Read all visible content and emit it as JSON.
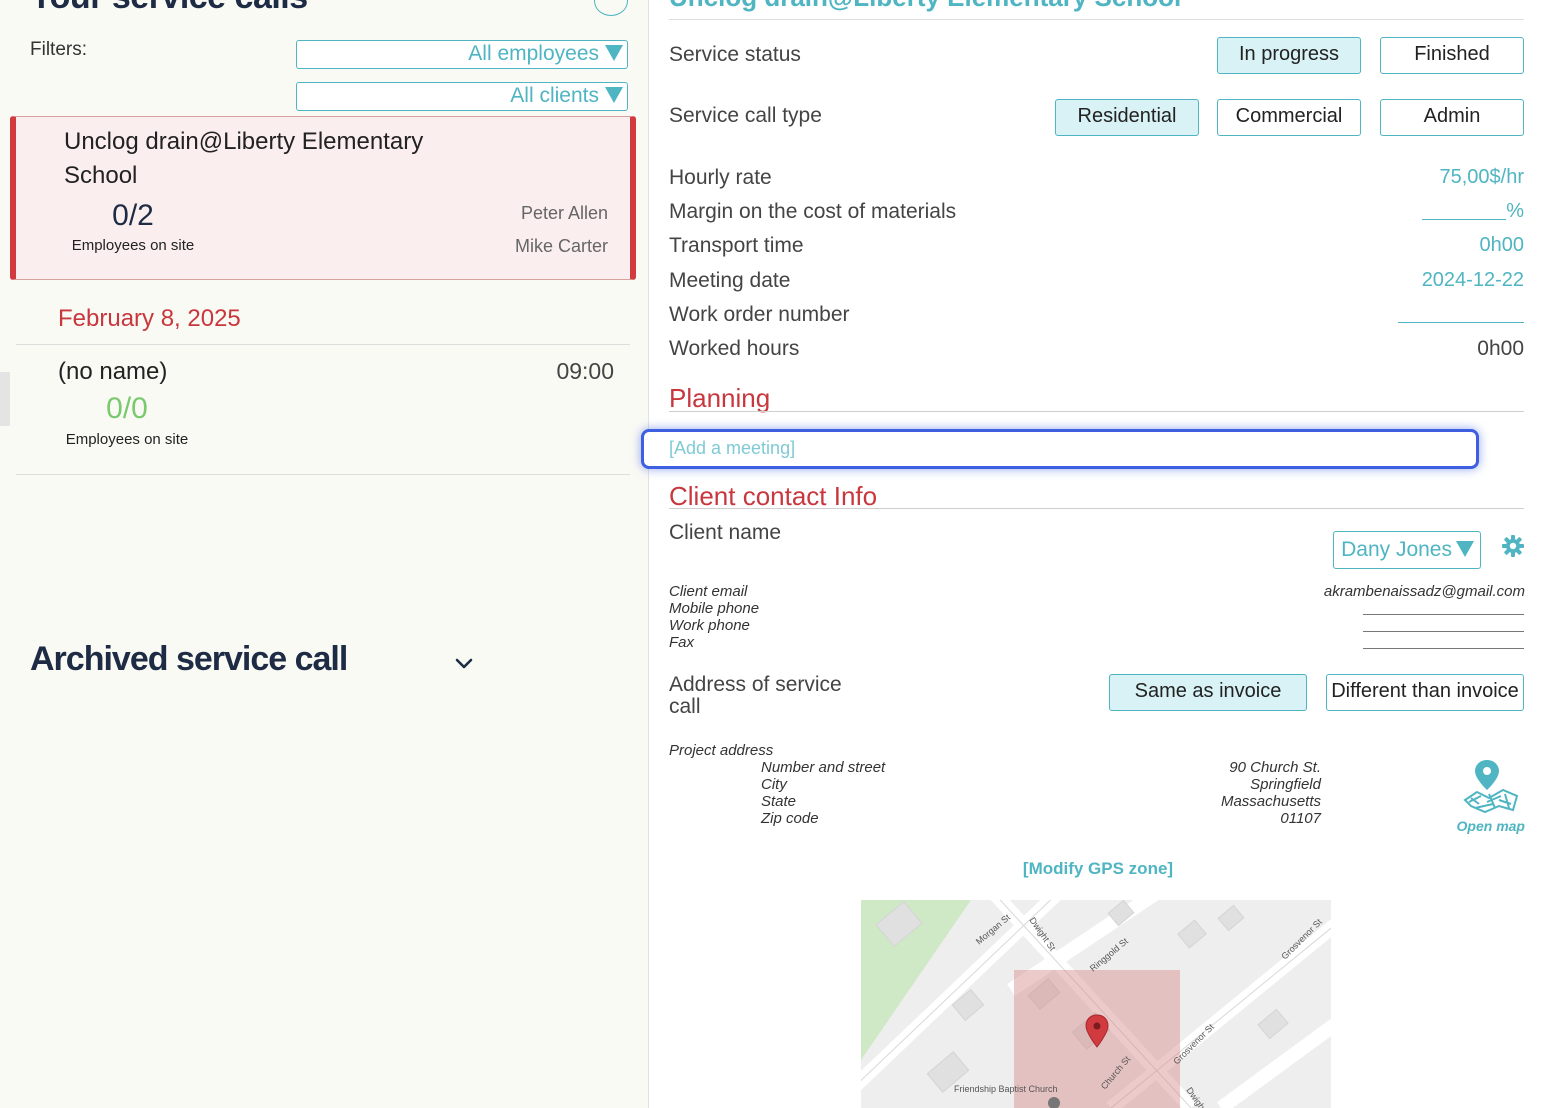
{
  "left_panel": {
    "title": "Your service calls",
    "filters_label": "Filters:",
    "employee_filter": "All employees",
    "client_filter": "All clients",
    "active_call": {
      "title": "Unclog drain@Liberty Elementary School",
      "employee_count": "0/2",
      "employees_label": "Employees on site",
      "employees": [
        "Peter Allen",
        "Mike Carter"
      ]
    },
    "date_header": "February 8, 2025",
    "call2": {
      "title": "(no name)",
      "time": "09:00",
      "employee_count": "0/0",
      "employees_label": "Employees on site"
    },
    "archived_title": "Archived service call"
  },
  "detail": {
    "title": "Unclog drain@Liberty Elementary School",
    "service_status_label": "Service status",
    "status_options": [
      "In progress",
      "Finished"
    ],
    "status_selected": "In progress",
    "type_label": "Service call type",
    "type_options": [
      "Residential",
      "Commercial",
      "Admin"
    ],
    "type_selected": "Residential",
    "hourly_rate_label": "Hourly rate",
    "hourly_rate": "75,00$/hr",
    "margin_label": "Margin on the cost of materials",
    "margin_suffix": "%",
    "transport_label": "Transport time",
    "transport_time": "0h00",
    "meeting_date_label": "Meeting date",
    "meeting_date": "2024-12-22",
    "work_order_label": "Work order number",
    "worked_hours_label": "Worked hours",
    "worked_hours": "0h00",
    "planning_title": "Planning",
    "add_meeting": "[Add a meeting]",
    "client_section_title": "Client contact Info",
    "client_name_label": "Client name",
    "client_name": "Dany Jones",
    "client_email_label": "Client email",
    "client_email": "akrambenaissadz@gmail.com",
    "mobile_label": "Mobile phone",
    "work_phone_label": "Work phone",
    "fax_label": "Fax",
    "address_label": "Address of service call",
    "address_options": [
      "Same as invoice",
      "Different than invoice"
    ],
    "address_selected": "Same as invoice",
    "project_address_label": "Project address",
    "street_label": "Number and street",
    "street": "90 Church St.",
    "city_label": "City",
    "city": "Springfield",
    "state_label": "State",
    "state": "Massachusetts",
    "zip_label": "Zip code",
    "zip": "01107",
    "open_map": "Open map",
    "modify_gps": "[Modify GPS zone]",
    "map_labels": [
      "Morgan St",
      "Dwight St",
      "Ringgold St",
      "Grosvenor St",
      "Church St",
      "Grosvenor St",
      "Friendship Baptist Church",
      "Dwight"
    ]
  },
  "colors": {
    "accent": "#4fb5c2",
    "danger": "#c8373d",
    "navy": "#1d2b44",
    "green": "#7bc96f",
    "focus": "#3d5fe0"
  }
}
